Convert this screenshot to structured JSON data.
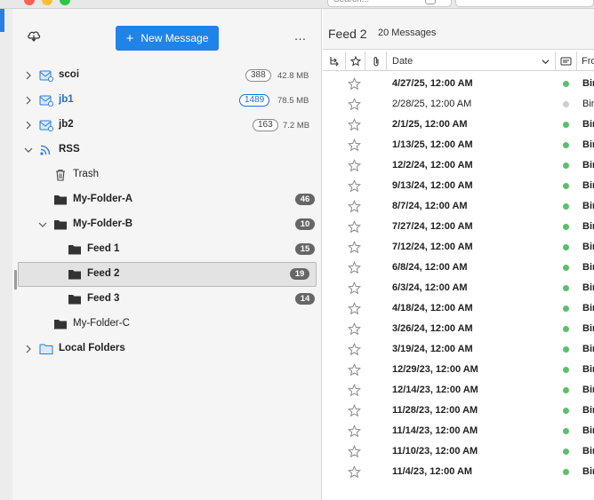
{
  "window": {
    "search_placeholder": "Search..."
  },
  "sidebar": {
    "new_message_label": "New Message",
    "more_label": "…",
    "folders": [
      {
        "name": "scoi",
        "count": "388",
        "size": "42.8 MB",
        "bold": true,
        "blue": false
      },
      {
        "name": "jb1",
        "count": "1489",
        "size": "78.5 MB",
        "bold": true,
        "blue": true
      },
      {
        "name": "jb2",
        "count": "163",
        "size": "7.2 MB",
        "bold": true,
        "blue": false
      },
      {
        "name": "RSS",
        "bold": true
      },
      {
        "name": "Trash"
      },
      {
        "name": "My-Folder-A",
        "badge": "46",
        "bold": true
      },
      {
        "name": "My-Folder-B",
        "badge": "10",
        "bold": true
      },
      {
        "name": "Feed 1",
        "badge": "15",
        "bold": true
      },
      {
        "name": "Feed 2",
        "badge": "19",
        "bold": true,
        "selected": true
      },
      {
        "name": "Feed 3",
        "badge": "14",
        "bold": true
      },
      {
        "name": "My-Folder-C"
      },
      {
        "name": "Local Folders",
        "bold": true
      }
    ]
  },
  "pane": {
    "title": "Feed 2",
    "message_count": "20 Messages",
    "columns": {
      "date": "Date",
      "from": "From"
    },
    "messages": [
      {
        "date": "4/27/25, 12:00 AM",
        "from": "Bing",
        "read": false
      },
      {
        "date": "2/28/25, 12:00 AM",
        "from": "Bing",
        "read": true
      },
      {
        "date": "2/1/25, 12:00 AM",
        "from": "Bing",
        "read": false
      },
      {
        "date": "1/13/25, 12:00 AM",
        "from": "Bing",
        "read": false
      },
      {
        "date": "12/2/24, 12:00 AM",
        "from": "Bing",
        "read": false
      },
      {
        "date": "9/13/24, 12:00 AM",
        "from": "Bing",
        "read": false
      },
      {
        "date": "8/7/24, 12:00 AM",
        "from": "Bing",
        "read": false
      },
      {
        "date": "7/27/24, 12:00 AM",
        "from": "Bing",
        "read": false
      },
      {
        "date": "7/12/24, 12:00 AM",
        "from": "Bing",
        "read": false
      },
      {
        "date": "6/8/24, 12:00 AM",
        "from": "Bing",
        "read": false
      },
      {
        "date": "6/3/24, 12:00 AM",
        "from": "Bing",
        "read": false
      },
      {
        "date": "4/18/24, 12:00 AM",
        "from": "Bing",
        "read": false
      },
      {
        "date": "3/26/24, 12:00 AM",
        "from": "Bing",
        "read": false
      },
      {
        "date": "3/19/24, 12:00 AM",
        "from": "Bing",
        "read": false
      },
      {
        "date": "12/29/23, 12:00 AM",
        "from": "Bing",
        "read": false
      },
      {
        "date": "12/14/23, 12:00 AM",
        "from": "Bing",
        "read": false
      },
      {
        "date": "11/28/23, 12:00 AM",
        "from": "Bing",
        "read": false
      },
      {
        "date": "11/14/23, 12:00 AM",
        "from": "Bing",
        "read": false
      },
      {
        "date": "11/10/23, 12:00 AM",
        "from": "Bing",
        "read": false
      },
      {
        "date": "11/4/23, 12:00 AM",
        "from": "Bing",
        "read": false
      }
    ]
  },
  "colors": {
    "accent": "#1f83e8",
    "unread_dot": "#5cbf6a",
    "read_dot": "#cfcfcf",
    "badge": "#666666"
  }
}
